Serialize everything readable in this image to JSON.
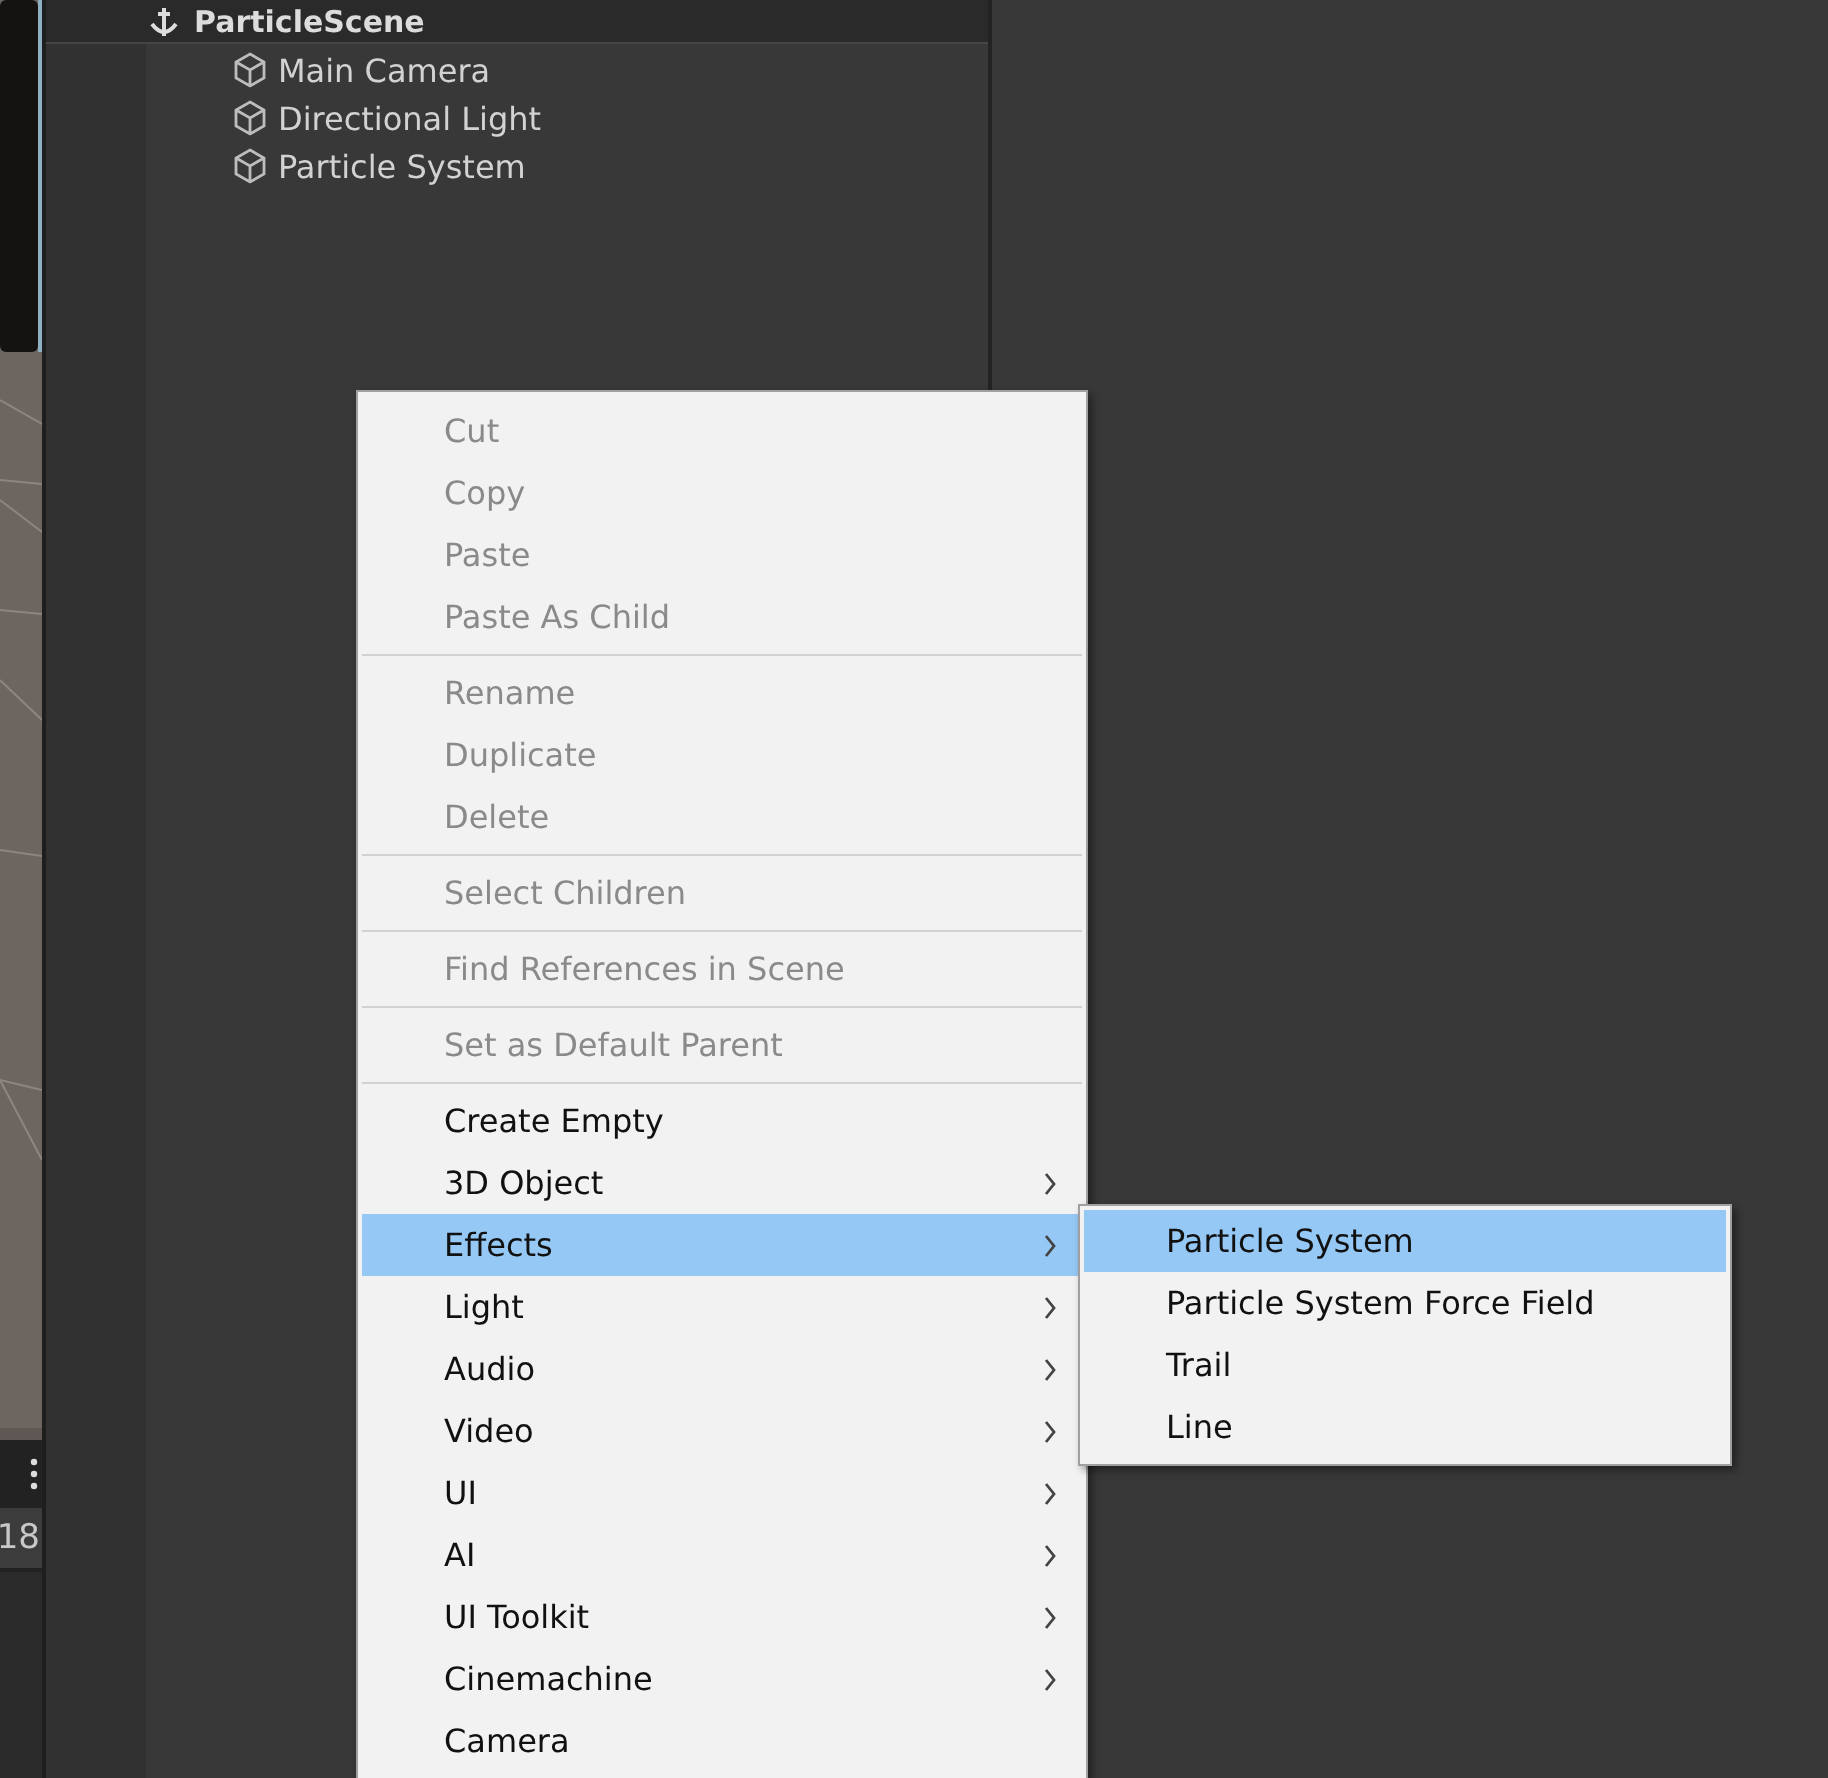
{
  "scene_view": {
    "counter": "18"
  },
  "hierarchy": {
    "scene": "ParticleScene",
    "objects": [
      {
        "name": "Main Camera"
      },
      {
        "name": "Directional Light"
      },
      {
        "name": "Particle System"
      }
    ]
  },
  "context_menu": {
    "items": [
      {
        "kind": "item",
        "label": "Cut",
        "disabled": true,
        "has_submenu": false,
        "selected": false
      },
      {
        "kind": "item",
        "label": "Copy",
        "disabled": true,
        "has_submenu": false,
        "selected": false
      },
      {
        "kind": "item",
        "label": "Paste",
        "disabled": true,
        "has_submenu": false,
        "selected": false
      },
      {
        "kind": "item",
        "label": "Paste As Child",
        "disabled": true,
        "has_submenu": false,
        "selected": false
      },
      {
        "kind": "separator"
      },
      {
        "kind": "item",
        "label": "Rename",
        "disabled": true,
        "has_submenu": false,
        "selected": false
      },
      {
        "kind": "item",
        "label": "Duplicate",
        "disabled": true,
        "has_submenu": false,
        "selected": false
      },
      {
        "kind": "item",
        "label": "Delete",
        "disabled": true,
        "has_submenu": false,
        "selected": false
      },
      {
        "kind": "separator"
      },
      {
        "kind": "item",
        "label": "Select Children",
        "disabled": true,
        "has_submenu": false,
        "selected": false
      },
      {
        "kind": "separator"
      },
      {
        "kind": "item",
        "label": "Find References in Scene",
        "disabled": true,
        "has_submenu": false,
        "selected": false
      },
      {
        "kind": "separator"
      },
      {
        "kind": "item",
        "label": "Set as Default Parent",
        "disabled": true,
        "has_submenu": false,
        "selected": false
      },
      {
        "kind": "separator"
      },
      {
        "kind": "item",
        "label": "Create Empty",
        "disabled": false,
        "has_submenu": false,
        "selected": false
      },
      {
        "kind": "item",
        "label": "3D Object",
        "disabled": false,
        "has_submenu": true,
        "selected": false
      },
      {
        "kind": "item",
        "label": "Effects",
        "disabled": false,
        "has_submenu": true,
        "selected": true
      },
      {
        "kind": "item",
        "label": "Light",
        "disabled": false,
        "has_submenu": true,
        "selected": false
      },
      {
        "kind": "item",
        "label": "Audio",
        "disabled": false,
        "has_submenu": true,
        "selected": false
      },
      {
        "kind": "item",
        "label": "Video",
        "disabled": false,
        "has_submenu": true,
        "selected": false
      },
      {
        "kind": "item",
        "label": "UI",
        "disabled": false,
        "has_submenu": true,
        "selected": false
      },
      {
        "kind": "item",
        "label": "AI",
        "disabled": false,
        "has_submenu": true,
        "selected": false
      },
      {
        "kind": "item",
        "label": "UI Toolkit",
        "disabled": false,
        "has_submenu": true,
        "selected": false
      },
      {
        "kind": "item",
        "label": "Cinemachine",
        "disabled": false,
        "has_submenu": true,
        "selected": false
      },
      {
        "kind": "item",
        "label": "Camera",
        "disabled": false,
        "has_submenu": false,
        "selected": false
      }
    ]
  },
  "submenu": {
    "items": [
      {
        "label": "Particle System",
        "selected": true
      },
      {
        "label": "Particle System Force Field",
        "selected": false
      },
      {
        "label": "Trail",
        "selected": false
      },
      {
        "label": "Line",
        "selected": false
      }
    ]
  }
}
